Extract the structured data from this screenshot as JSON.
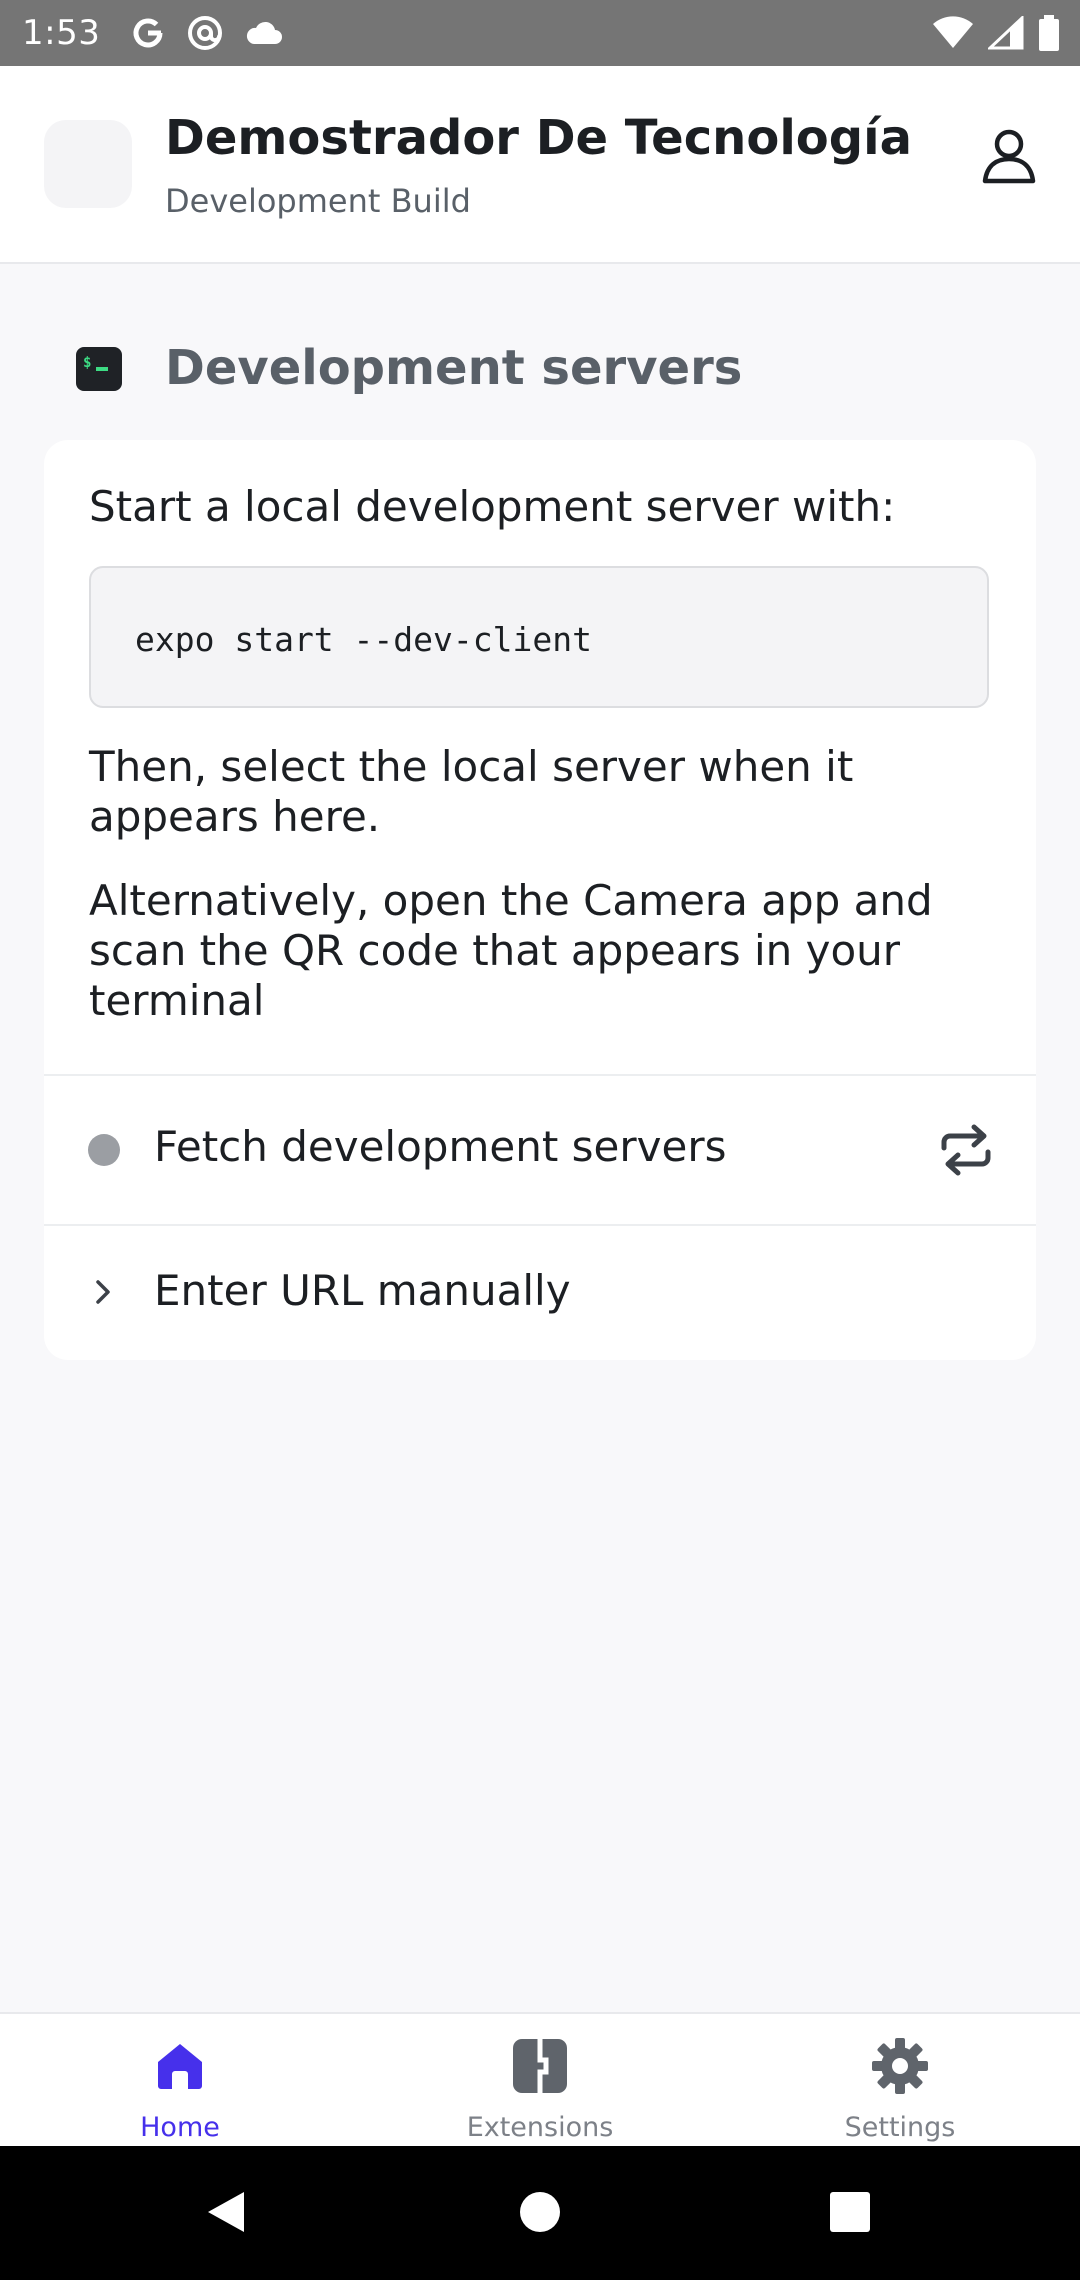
{
  "status_bar": {
    "time": "1:53",
    "icons_left": [
      "google-icon",
      "at-sign-icon",
      "cloud-icon"
    ],
    "icons_right": [
      "wifi-icon",
      "cellular-signal-icon",
      "battery-icon"
    ]
  },
  "header": {
    "title": "Demostrador De Tecnología",
    "subtitle": "Development Build"
  },
  "section": {
    "title": "Development servers"
  },
  "card": {
    "intro": "Start a local development server with:",
    "code": "expo start --dev-client",
    "then_text": "Then, select the local server when it appears here.",
    "alt_text": "Alternatively, open the Camera app and scan the QR code that appears in your terminal",
    "fetch_label": "Fetch development servers",
    "url_label": "Enter URL manually"
  },
  "tabs": [
    {
      "label": "Home",
      "icon": "home-icon",
      "active": true
    },
    {
      "label": "Extensions",
      "icon": "extensions-icon",
      "active": false
    },
    {
      "label": "Settings",
      "icon": "gear-icon",
      "active": false
    }
  ],
  "colors": {
    "accent": "#4630eb",
    "status_bar": "#757575",
    "background": "#f8f8fa",
    "inactive": "#7d8188"
  }
}
